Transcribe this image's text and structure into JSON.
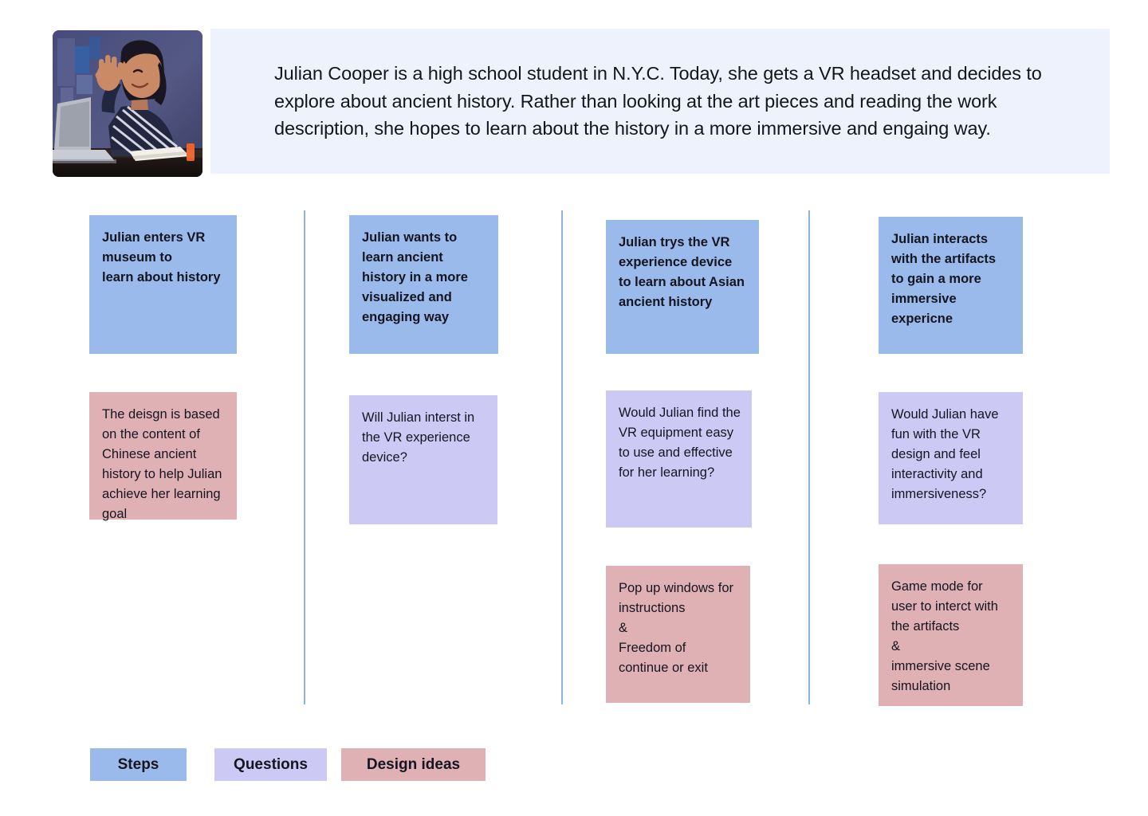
{
  "header": {
    "photo_alt": "persona-photo-woman-waving-at-laptop",
    "description": "Julian Cooper is a high school student in N.Y.C. Today, she gets a VR headset and decides to explore about ancient history. Rather than looking at the art pieces and reading the work description, she hopes to learn about the history in a more immersive and engaing way."
  },
  "board": {
    "columns": [
      {
        "step": "Julian enters VR museum to\nlearn about history",
        "question": null,
        "idea": "The deisgn is based on the content of Chinese ancient history to help Julian achieve her learning goal"
      },
      {
        "step": "Julian wants to learn ancient history in a more visualized and engaging way",
        "question": "Will Julian interst in the VR experience device?",
        "idea": null
      },
      {
        "step": "Julian trys the VR experience device to learn about Asian ancient history",
        "question": "Would Julian find the VR equipment easy to use and effective for her learning?",
        "idea": "Pop up windows for instructions\n&\nFreedom of continue or exit"
      },
      {
        "step": "Julian interacts with the artifacts to gain a more immersive expericne",
        "question": "Would Julian have fun with the VR design and feel interactivity and immersiveness?",
        "idea": "Game mode for user to interct with the artifacts\n&\nimmersive scene simulation"
      }
    ]
  },
  "legend": {
    "steps_label": "Steps",
    "questions_label": "Questions",
    "ideas_label": "Design ideas"
  },
  "colors": {
    "step": "#9ABAEB",
    "question": "#CCCAF5",
    "idea": "#DFB1B5",
    "banner": "#EEF2FC",
    "divider": "#8CB4E2",
    "text": "#151520"
  }
}
